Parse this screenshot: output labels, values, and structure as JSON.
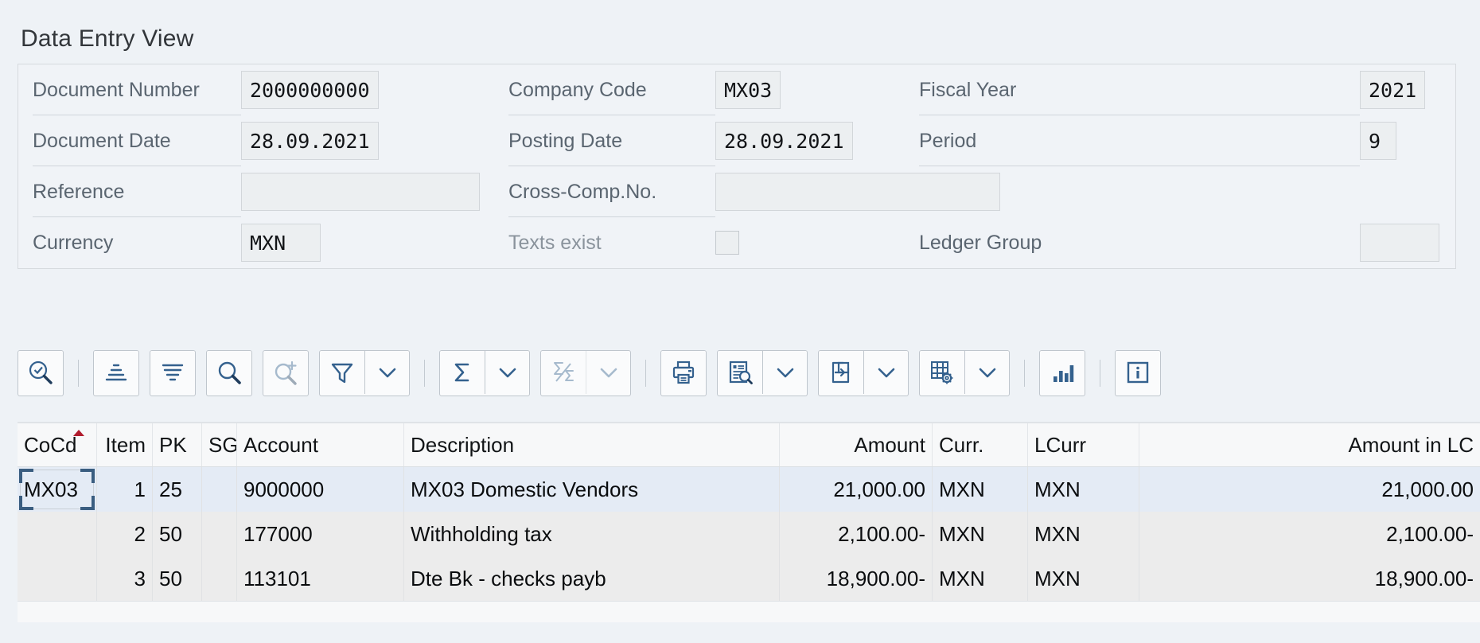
{
  "page_title": "Data Entry View",
  "header_form": {
    "rows": [
      {
        "fields": [
          {
            "label": "Document Number",
            "value": "2000000000",
            "type": "text"
          },
          {
            "label": "Company Code",
            "value": "MX03",
            "type": "text"
          },
          {
            "label": "Fiscal Year",
            "value": "2021",
            "type": "text"
          }
        ]
      },
      {
        "fields": [
          {
            "label": "Document Date",
            "value": "28.09.2021",
            "type": "text"
          },
          {
            "label": "Posting Date",
            "value": "28.09.2021",
            "type": "text"
          },
          {
            "label": "Period",
            "value": "9",
            "type": "text"
          }
        ]
      },
      {
        "fields": [
          {
            "label": "Reference",
            "value": "",
            "type": "text"
          },
          {
            "label": "Cross-Comp.No.",
            "value": "",
            "type": "text"
          },
          {
            "label": "",
            "value": "",
            "type": "none"
          }
        ]
      },
      {
        "fields": [
          {
            "label": "Currency",
            "value": "MXN",
            "type": "text"
          },
          {
            "label": "Texts exist",
            "value": "",
            "type": "checkbox",
            "checked": false,
            "disabled": true
          },
          {
            "label": "Ledger Group",
            "value": "",
            "type": "text"
          }
        ]
      }
    ]
  },
  "toolbar": {
    "groups": [
      {
        "buttons": [
          {
            "name": "find-layout-icon",
            "label": "Find Layout",
            "disabled": false
          }
        ]
      },
      {
        "buttons": [
          {
            "name": "subtotal-levels-icon",
            "label": "Subtotal Levels",
            "disabled": false
          }
        ]
      },
      {
        "buttons": [
          {
            "name": "sort-filter-icon",
            "label": "Sort / Filter Lines",
            "disabled": false
          }
        ]
      },
      {
        "buttons": [
          {
            "name": "search-icon",
            "label": "Find",
            "disabled": false
          }
        ]
      },
      {
        "buttons": [
          {
            "name": "search-plus-icon",
            "label": "Find Next",
            "disabled": true
          }
        ]
      },
      {
        "buttons": [
          {
            "name": "filter-icon",
            "label": "Set Filter",
            "disabled": false
          },
          {
            "name": "filter-menu-chevron-down-icon",
            "label": "Filter Menu",
            "disabled": false
          }
        ]
      },
      {
        "buttons": [
          {
            "name": "total-sigma-icon",
            "label": "Total",
            "disabled": false
          },
          {
            "name": "total-menu-chevron-down-icon",
            "label": "Total Menu",
            "disabled": false
          }
        ]
      },
      {
        "buttons": [
          {
            "name": "subtotal-sigma-icon",
            "label": "Subtotal",
            "disabled": true
          },
          {
            "name": "subtotal-menu-chevron-down-icon",
            "label": "Subtotal Menu",
            "disabled": true
          }
        ]
      },
      {
        "buttons": [
          {
            "name": "print-icon",
            "label": "Print",
            "disabled": false
          }
        ]
      },
      {
        "buttons": [
          {
            "name": "print-preview-icon",
            "label": "Print Preview",
            "disabled": false
          },
          {
            "name": "print-preview-chevron-down-icon",
            "label": "Print Preview Menu",
            "disabled": false
          }
        ]
      },
      {
        "buttons": [
          {
            "name": "export-icon",
            "label": "Export",
            "disabled": false
          },
          {
            "name": "export-chevron-down-icon",
            "label": "Export Menu",
            "disabled": false
          }
        ]
      },
      {
        "buttons": [
          {
            "name": "layout-settings-icon",
            "label": "Change Layout",
            "disabled": false
          },
          {
            "name": "layout-settings-chevron-down-icon",
            "label": "Layout Menu",
            "disabled": false
          }
        ]
      },
      {
        "buttons": [
          {
            "name": "chart-bar-icon",
            "label": "Graphic",
            "disabled": false
          }
        ]
      },
      {
        "buttons": [
          {
            "name": "info-icon",
            "label": "Information",
            "disabled": false
          }
        ]
      }
    ]
  },
  "grid": {
    "sort_column": "CoCd",
    "columns": [
      {
        "key": "cocd",
        "label": "CoCd",
        "align": "left"
      },
      {
        "key": "item",
        "label": "Item",
        "align": "right"
      },
      {
        "key": "pk",
        "label": "PK",
        "align": "left"
      },
      {
        "key": "sg",
        "label": "SG",
        "align": "left"
      },
      {
        "key": "account",
        "label": "Account",
        "align": "left"
      },
      {
        "key": "desc",
        "label": "Description",
        "align": "left"
      },
      {
        "key": "amount",
        "label": "Amount",
        "align": "right"
      },
      {
        "key": "curr",
        "label": "Curr.",
        "align": "left"
      },
      {
        "key": "lcurr",
        "label": "LCurr",
        "align": "left"
      },
      {
        "key": "amtlc",
        "label": "Amount in LC",
        "align": "right"
      }
    ],
    "rows": [
      {
        "cocd": "MX03",
        "item": "1",
        "pk": "25",
        "sg": "",
        "account": "9000000",
        "desc": "MX03 Domestic Vendors",
        "amount": "21,000.00",
        "curr": "MXN",
        "lcurr": "MXN",
        "amtlc": "21,000.00",
        "selected": true
      },
      {
        "cocd": "",
        "item": "2",
        "pk": "50",
        "sg": "",
        "account": "177000",
        "desc": "Withholding tax",
        "amount": "2,100.00-",
        "curr": "MXN",
        "lcurr": "MXN",
        "amtlc": "2,100.00-",
        "selected": false
      },
      {
        "cocd": "",
        "item": "3",
        "pk": "50",
        "sg": "",
        "account": "113101",
        "desc": "Dte Bk - checks payb",
        "amount": "18,900.00-",
        "curr": "MXN",
        "lcurr": "MXN",
        "amtlc": "18,900.00-",
        "selected": false
      }
    ]
  },
  "colors": {
    "background": "#eef2f6",
    "panel": "#f0f3f7",
    "field": "#eceff1",
    "icon_blue": "#34618e",
    "selected_row": "#e4ebf5",
    "alt_row": "#ececec",
    "sort_marker": "#b01c2e"
  }
}
